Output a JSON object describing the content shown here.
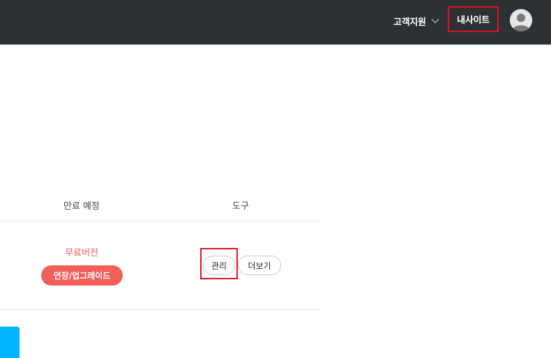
{
  "header": {
    "support_label": "고객지원",
    "support_icon": "chevron-down-icon",
    "mysite_label": "내사이트",
    "avatar_icon": "user-avatar-icon"
  },
  "table": {
    "columns": [
      "만료 예정",
      "도구"
    ],
    "row": {
      "status": "무료버전",
      "upgrade_label": "연장/업그레이드",
      "tools": [
        "관리",
        "더보기"
      ]
    }
  },
  "colors": {
    "header_bg": "#2e3134",
    "highlight_border": "#e0141c",
    "status_red": "#f05a5a",
    "upgrade_bg": "#f05f5a",
    "blue_tab": "#00b3ff"
  }
}
